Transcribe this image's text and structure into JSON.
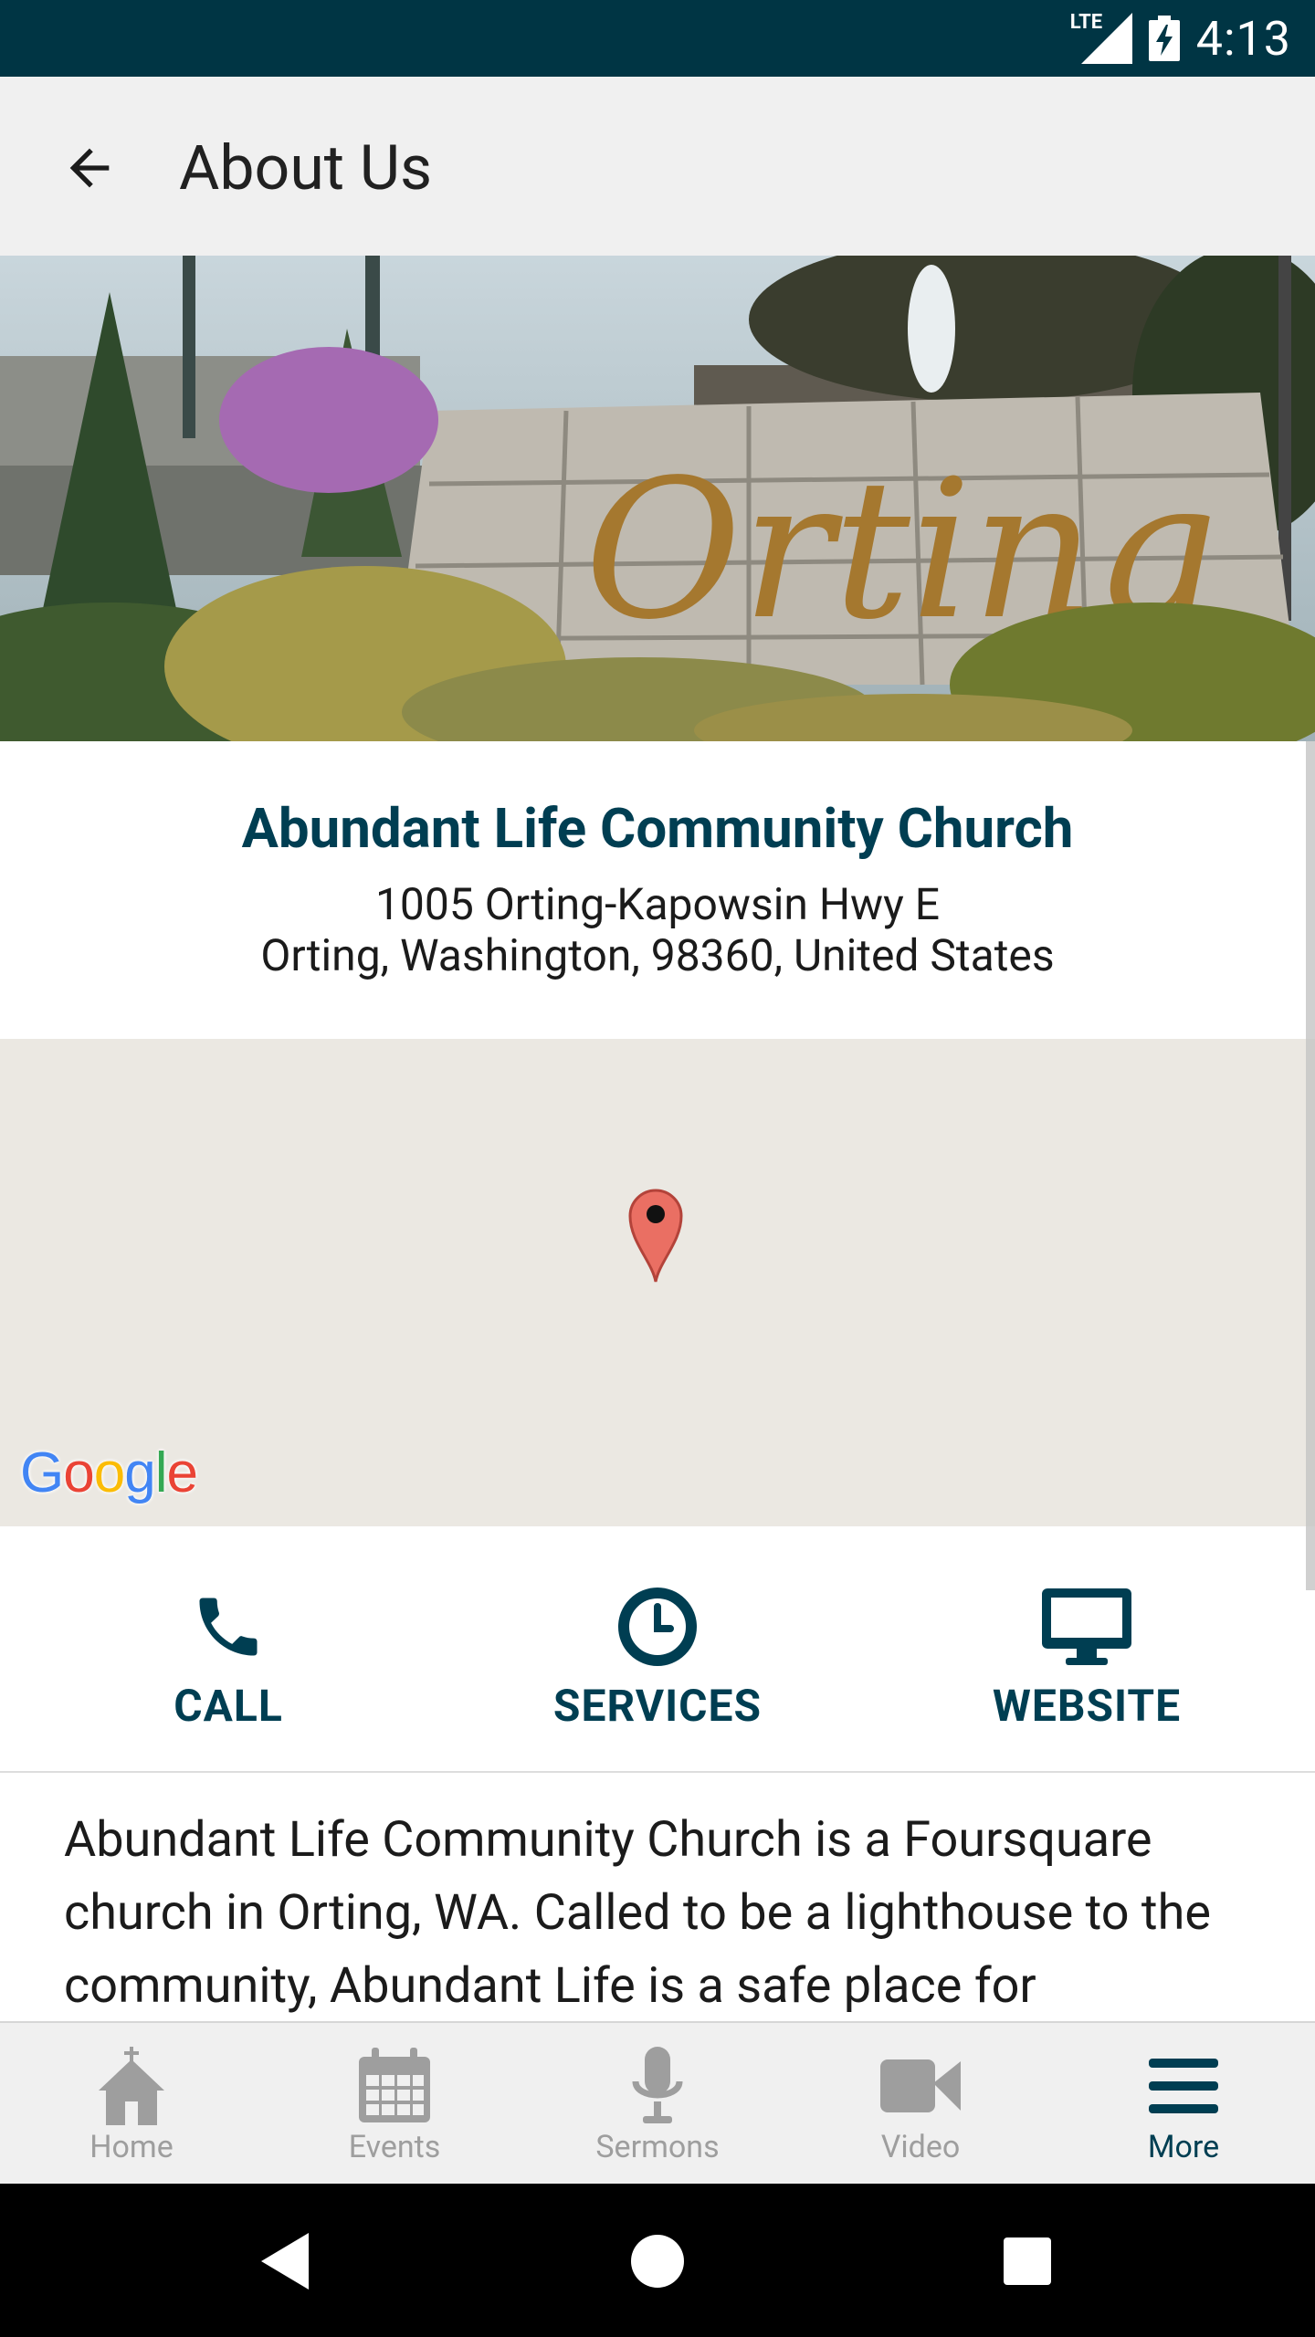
{
  "status_bar": {
    "network": "LTE",
    "time": "4:13"
  },
  "app_bar": {
    "title": "About Us"
  },
  "hero": {
    "sign_text": "Orting"
  },
  "church": {
    "name": "Abundant Life Community Church",
    "address_line1": "1005 Orting-Kapowsin Hwy E",
    "address_line2": "Orting, Washington, 98360, United States"
  },
  "map": {
    "attribution": "Google"
  },
  "actions": [
    {
      "label": "CALL",
      "icon": "phone-icon"
    },
    {
      "label": "SERVICES",
      "icon": "clock-icon"
    },
    {
      "label": "WEBSITE",
      "icon": "monitor-icon"
    }
  ],
  "description": "Abundant Life Community Church is a Foursquare church in Orting, WA.  Called to be a lighthouse to the community, Abundant Life is a safe place for",
  "bottom_nav": [
    {
      "label": "Home",
      "icon": "church-icon",
      "active": false
    },
    {
      "label": "Events",
      "icon": "calendar-icon",
      "active": false
    },
    {
      "label": "Sermons",
      "icon": "microphone-icon",
      "active": false
    },
    {
      "label": "Video",
      "icon": "video-camera-icon",
      "active": false
    },
    {
      "label": "More",
      "icon": "menu-icon",
      "active": true
    }
  ],
  "colors": {
    "primary": "#003e52",
    "status_bar": "#003544",
    "inactive": "#9e9e9e",
    "map_pin": "#ea6f63"
  }
}
